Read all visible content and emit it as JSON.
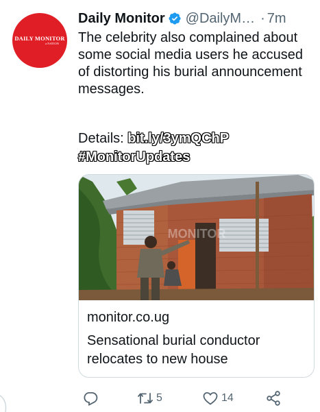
{
  "author": {
    "avatar_text": "DAILY MONITOR",
    "avatar_subtext": "a NATION",
    "name": "Daily Monitor",
    "handle": "@DailyM…",
    "separator": "·",
    "time": "7m"
  },
  "icons": {
    "verified": "verified-badge-icon",
    "more": "more-options-icon",
    "reply": "reply-icon",
    "retweet": "retweet-icon",
    "like": "like-icon",
    "share": "share-icon"
  },
  "tweet": {
    "text": "The celebrity also complained about some social media users he accused of distorting his burial announcement messages.",
    "details_label": "Details: ",
    "link": "bit.ly/3ymQChP",
    "hashtag": "#MonitorUpdates"
  },
  "card": {
    "watermark": "MONITOR",
    "domain": "monitor.co.ug",
    "title": "Sensational burial conductor relocates to new house"
  },
  "actions": {
    "reply_count": "",
    "retweet_count": "5",
    "like_count": "14"
  },
  "colors": {
    "brand_red": "#e01e26",
    "verified_blue": "#1d9bf0",
    "text_primary": "#0f1419",
    "text_secondary": "#536471",
    "border": "#cfd9de"
  }
}
